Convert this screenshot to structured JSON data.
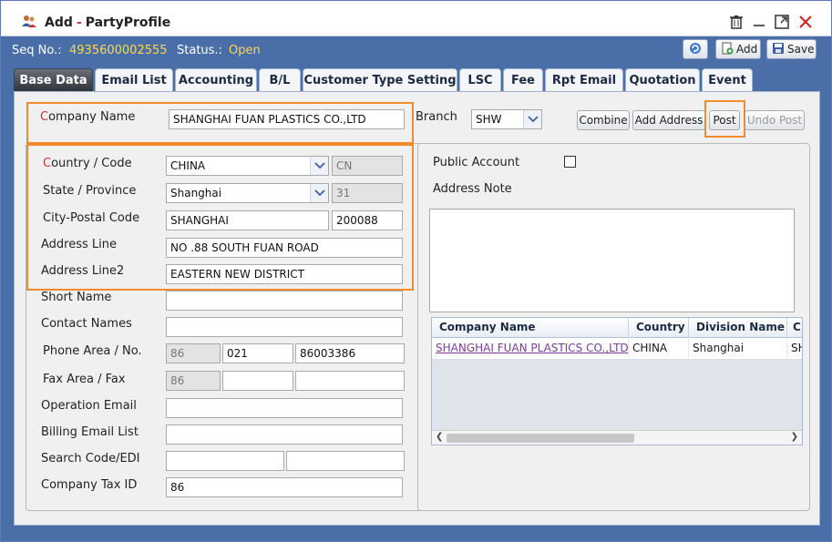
{
  "window": {
    "title_action": "Add",
    "title_separator": "-",
    "title_name": "PartyProfile"
  },
  "infobar": {
    "seq_label": "Seq No.:",
    "seq_value": "4935600002555",
    "status_label": "Status.:",
    "status_value": "Open",
    "add_label": "Add",
    "save_label": "Save"
  },
  "tabs": [
    {
      "label": "Base Data"
    },
    {
      "label": "Email List"
    },
    {
      "label": "Accounting"
    },
    {
      "label": "B/L"
    },
    {
      "label": "Customer Type Setting"
    },
    {
      "label": "LSC"
    },
    {
      "label": "Fee"
    },
    {
      "label": "Rpt Email"
    },
    {
      "label": "Quotation"
    },
    {
      "label": "Event"
    }
  ],
  "form": {
    "company_name_label_first": "C",
    "company_name_label_rest": "ompany Name",
    "company_name_value": "SHANGHAI FUAN PLASTICS CO.,LTD",
    "branch_label": "Branch",
    "branch_value": "SHW",
    "buttons": {
      "combine": "Combine",
      "add_address": "Add Address",
      "post": "Post",
      "undo_post": "Undo Post"
    },
    "country_label_first": "C",
    "country_label_rest": "ountry / Code",
    "country_value": "CHINA",
    "country_code": "CN",
    "state_label": "State / Province",
    "state_value": "Shanghai",
    "state_code": "31",
    "city_label": "City-Postal Code",
    "city_value": "SHANGHAI",
    "postal_value": "200088",
    "address_label": "Address Line",
    "address_value": "NO .88 SOUTH FUAN ROAD",
    "address2_label": "Address Line2",
    "address2_value": "EASTERN NEW DISTRICT",
    "short_name_label": "Short Name",
    "short_name_value": "",
    "contact_label": "Contact Names",
    "contact_value": "",
    "phone_label": "Phone Area / No.",
    "phone_country": "86",
    "phone_area": "021",
    "phone_number": "86003386",
    "fax_label": "Fax Area / Fax",
    "fax_country": "86",
    "fax_area": "",
    "fax_number": "",
    "op_email_label": "Operation Email",
    "op_email_value": "",
    "billing_email_label": "Billing Email List",
    "billing_email_value": "",
    "search_code_label": "Search Code/EDI",
    "search_code_value": "",
    "search_edi_value": "",
    "tax_id_label": "Company Tax ID",
    "tax_id_value": "86"
  },
  "right": {
    "public_account_label": "Public Account",
    "public_account_checked": false,
    "address_note_label": "Address Note",
    "address_note_value": "",
    "grid": {
      "columns": [
        "Company Name",
        "Country",
        "Division Name",
        "C"
      ],
      "rows": [
        {
          "company": "SHANGHAI FUAN PLASTICS CO.,LTD",
          "country": "CHINA",
          "division": "Shanghai",
          "extra": "SH"
        }
      ]
    }
  },
  "colors": {
    "accent_blue": "#4a6ea8",
    "status_yellow": "#ffd84a",
    "highlight_orange": "#f08a2c",
    "required_red": "#c0392b",
    "link_purple": "#7a3b9a"
  }
}
